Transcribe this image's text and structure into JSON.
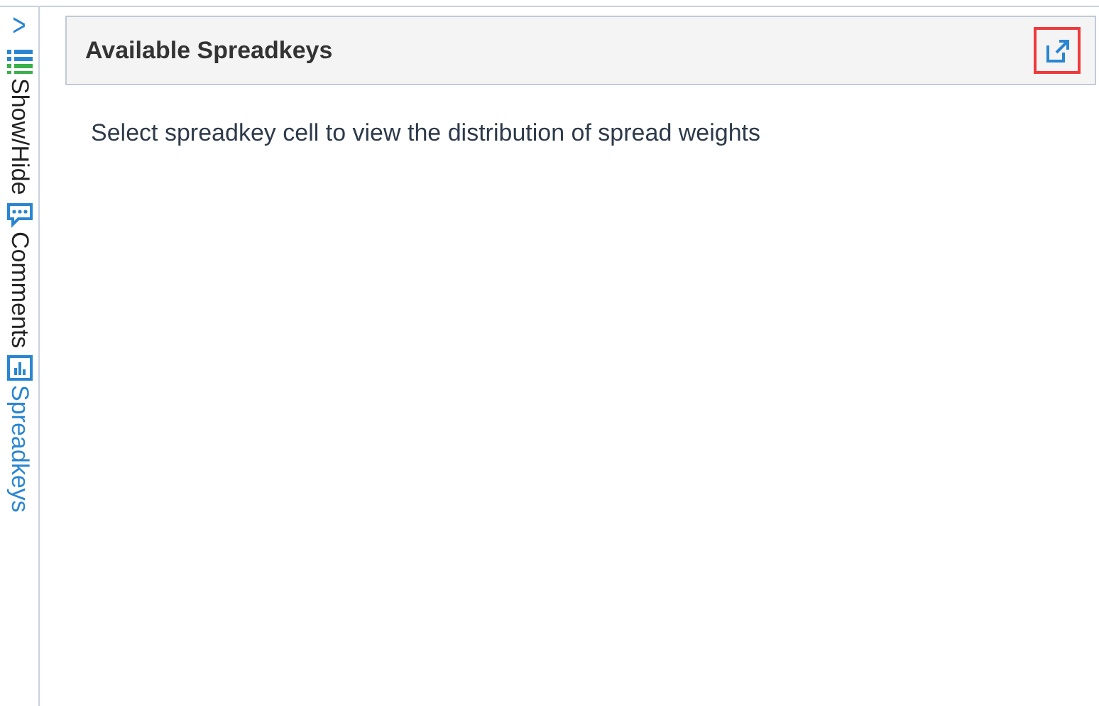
{
  "sidebar": {
    "collapse_glyph": ">",
    "tabs": [
      {
        "kind": "list",
        "label": "Show/Hide",
        "selected": false
      },
      {
        "kind": "comment",
        "label": "Comments",
        "selected": false
      },
      {
        "kind": "chart",
        "label": "Spreadkeys",
        "selected": true
      }
    ]
  },
  "panel": {
    "title": "Available Spreadkeys",
    "popout_highlighted": true,
    "message": "Select spreadkey cell to view the distribution of spread weights"
  }
}
